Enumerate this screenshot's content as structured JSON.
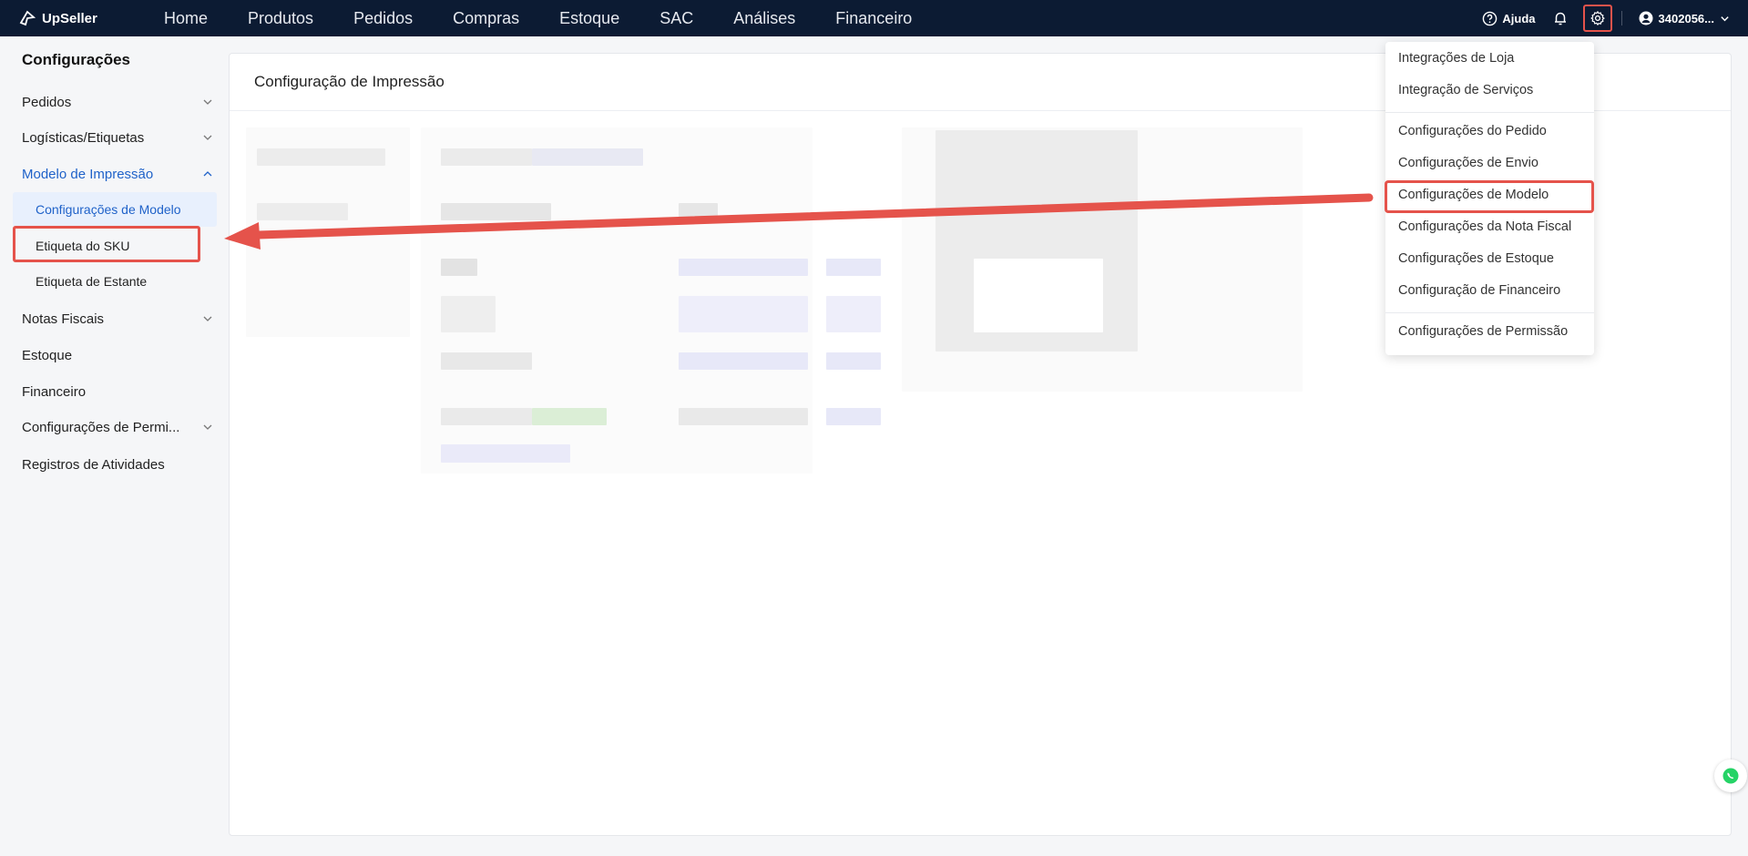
{
  "app": {
    "brand": "UpSeller"
  },
  "topnav": {
    "items": [
      "Home",
      "Produtos",
      "Pedidos",
      "Compras",
      "Estoque",
      "SAC",
      "Análises",
      "Financeiro"
    ],
    "help_label": "Ajuda",
    "user_label": "3402056..."
  },
  "sidebar": {
    "title": "Configurações",
    "items": [
      {
        "label": "Pedidos"
      },
      {
        "label": "Logísticas/Etiquetas"
      },
      {
        "label": "Modelo de Impressão"
      },
      {
        "label": "Configurações de Modelo"
      },
      {
        "label": "Etiqueta do SKU"
      },
      {
        "label": "Etiqueta de Estante"
      },
      {
        "label": "Notas Fiscais"
      },
      {
        "label": "Estoque"
      },
      {
        "label": "Financeiro"
      },
      {
        "label": "Configurações de Permi..."
      },
      {
        "label": "Registros de Atividades"
      }
    ]
  },
  "main": {
    "title": "Configuração de Impressão"
  },
  "settings_menu": {
    "items": [
      "Integrações de Loja",
      "Integração de Serviços",
      "Configurações do Pedido",
      "Configurações de Envio",
      "Configurações de Modelo",
      "Configurações da Nota Fiscal",
      "Configurações de Estoque",
      "Configuração de Financeiro",
      "Configurações de Permissão"
    ]
  },
  "colors": {
    "nav_bg": "#0c1b33",
    "accent": "#1f62c9",
    "highlight": "#e5534b"
  }
}
